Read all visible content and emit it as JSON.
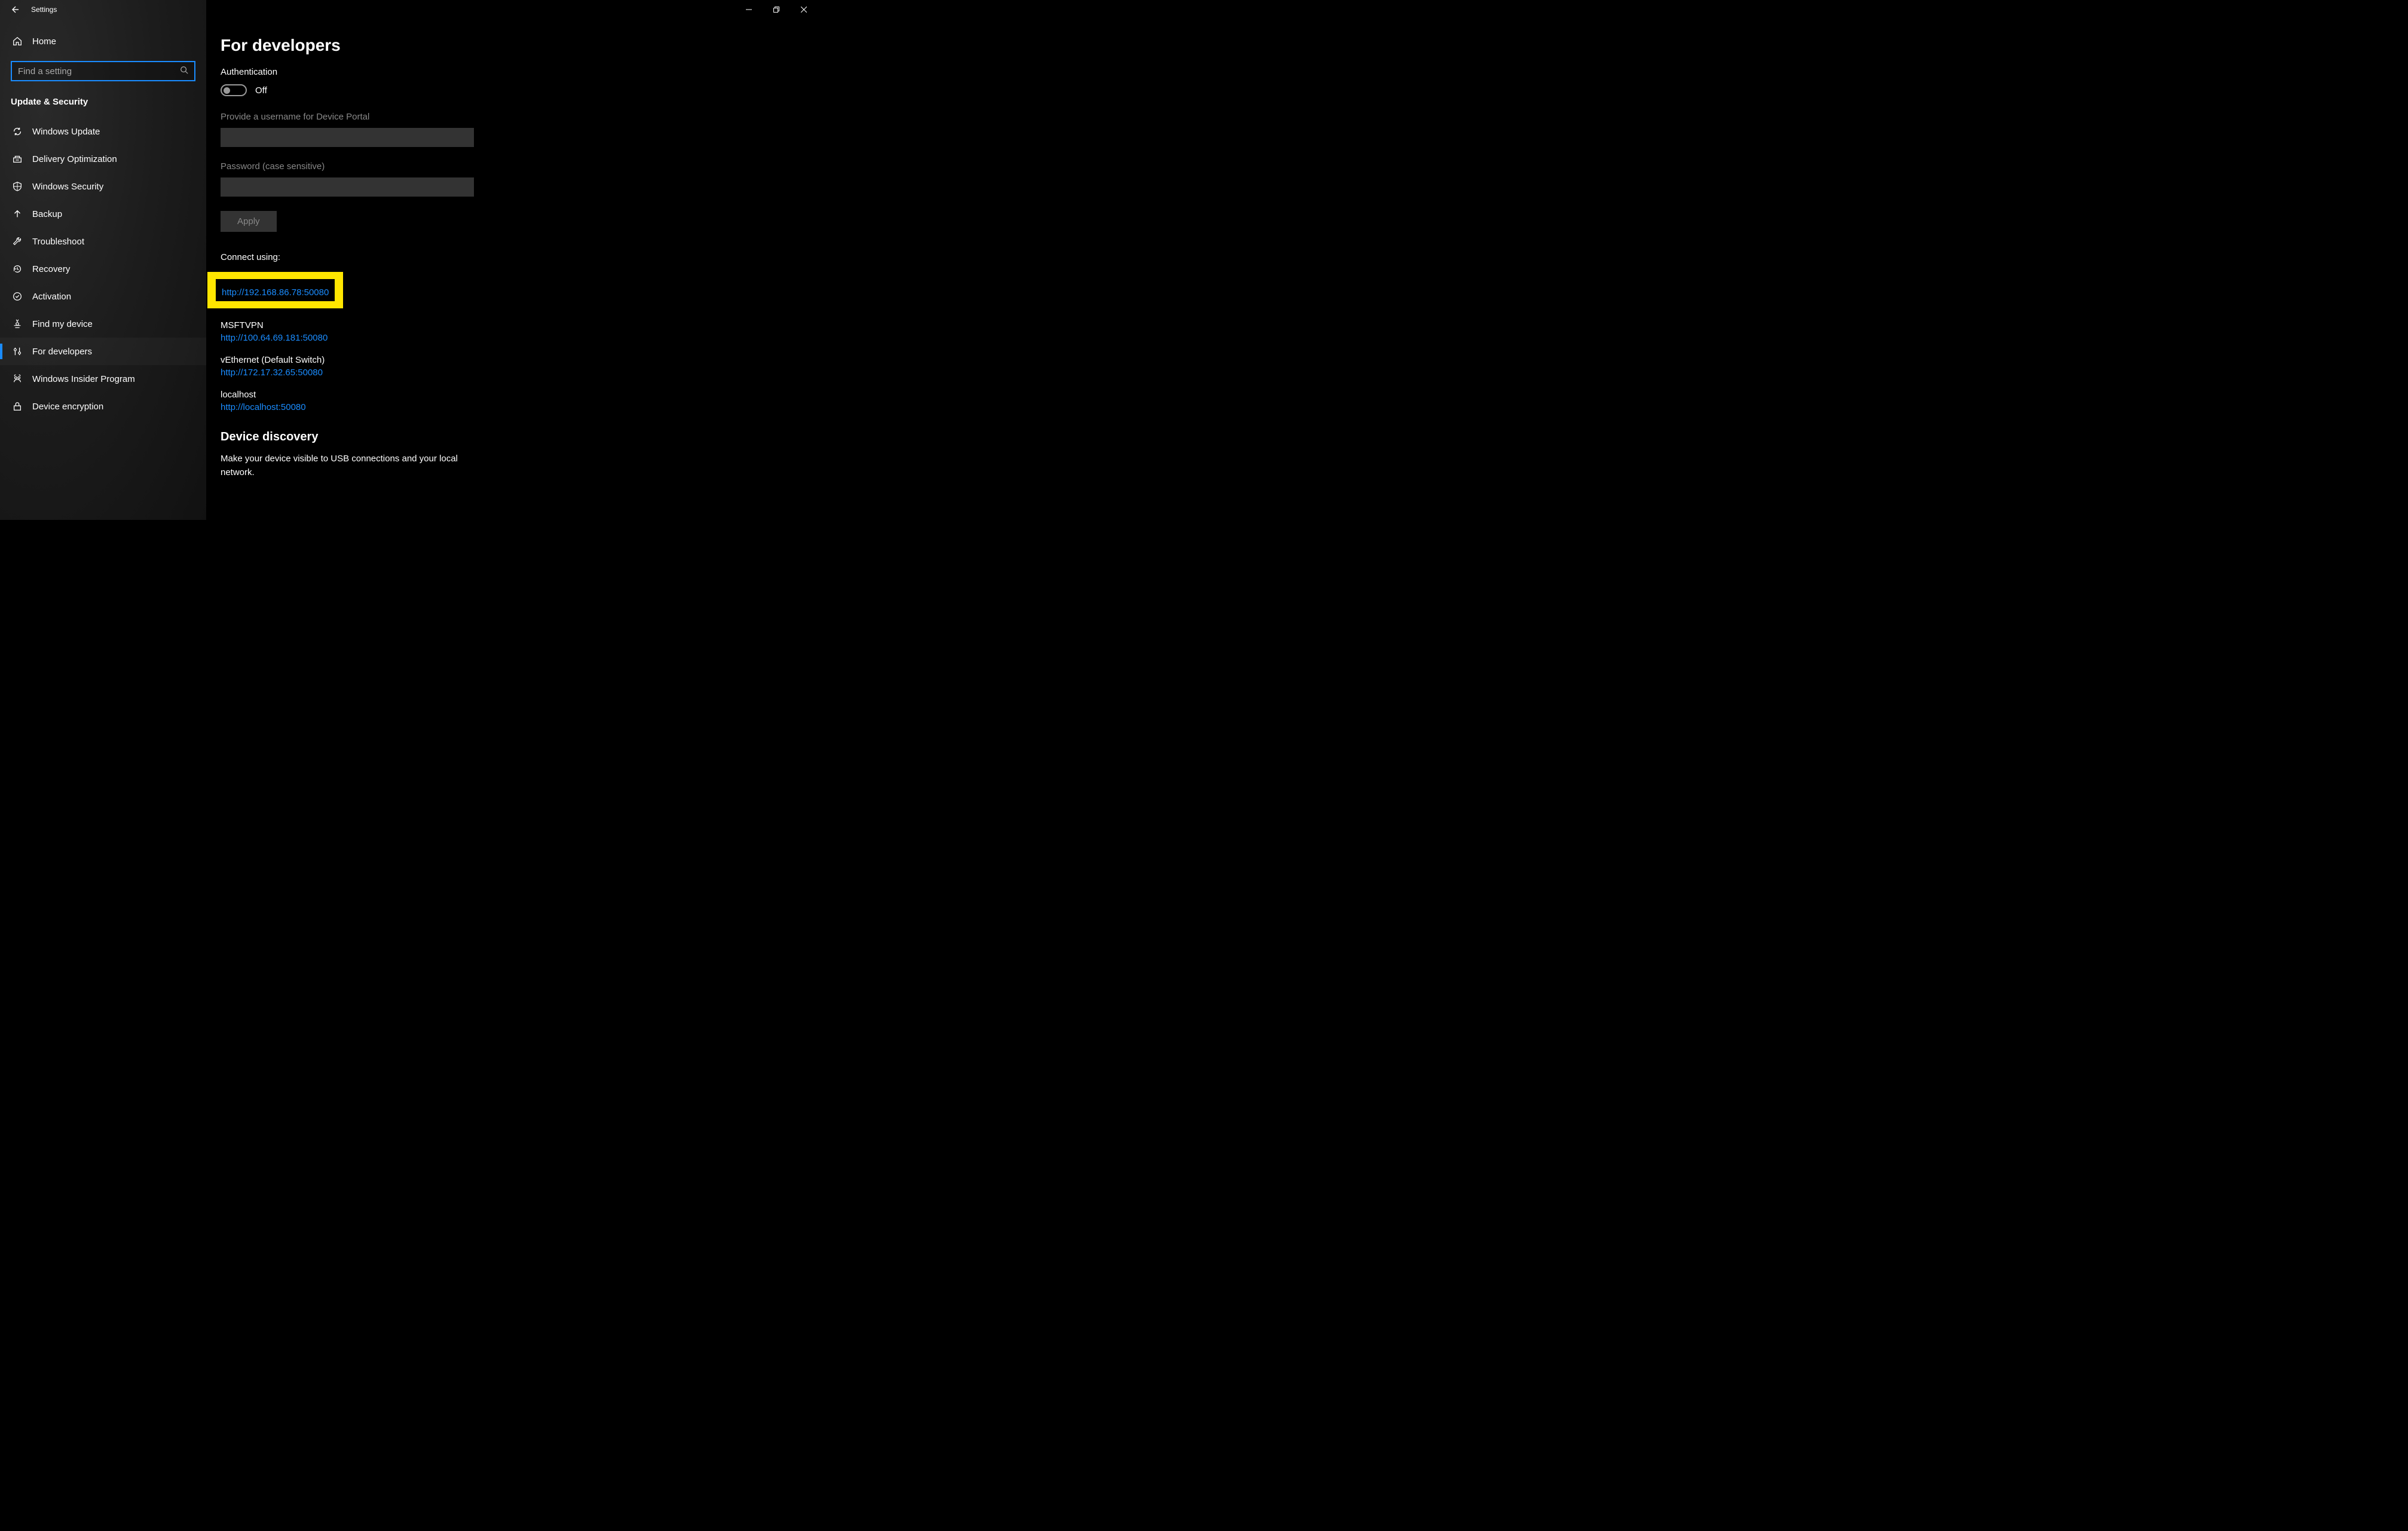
{
  "window": {
    "title": "Settings"
  },
  "sidebar": {
    "home": "Home",
    "search_placeholder": "Find a setting",
    "category": "Update & Security",
    "items": [
      {
        "label": "Windows Update",
        "icon": "refresh"
      },
      {
        "label": "Delivery Optimization",
        "icon": "delivery"
      },
      {
        "label": "Windows Security",
        "icon": "shield"
      },
      {
        "label": "Backup",
        "icon": "arrow-up"
      },
      {
        "label": "Troubleshoot",
        "icon": "wrench"
      },
      {
        "label": "Recovery",
        "icon": "clock-back"
      },
      {
        "label": "Activation",
        "icon": "check-circle"
      },
      {
        "label": "Find my device",
        "icon": "location"
      },
      {
        "label": "For developers",
        "icon": "sliders",
        "active": true
      },
      {
        "label": "Windows Insider Program",
        "icon": "insider"
      },
      {
        "label": "Device encryption",
        "icon": "lock"
      }
    ]
  },
  "main": {
    "page_title": "For developers",
    "auth": {
      "heading": "Authentication",
      "toggle_state": "Off",
      "username_label": "Provide a username for Device Portal",
      "username_value": "",
      "password_label": "Password (case sensitive)",
      "password_value": "",
      "apply_label": "Apply"
    },
    "connect": {
      "heading": "Connect using:",
      "entries": [
        {
          "name": "",
          "url": "http://192.168.86.78:50080",
          "highlighted": true
        },
        {
          "name": "MSFTVPN",
          "url": "http://100.64.69.181:50080"
        },
        {
          "name": "vEthernet (Default Switch)",
          "url": "http://172.17.32.65:50080"
        },
        {
          "name": "localhost",
          "url": "http://localhost:50080"
        }
      ]
    },
    "discovery": {
      "heading": "Device discovery",
      "desc": "Make your device visible to USB connections and your local network."
    }
  }
}
